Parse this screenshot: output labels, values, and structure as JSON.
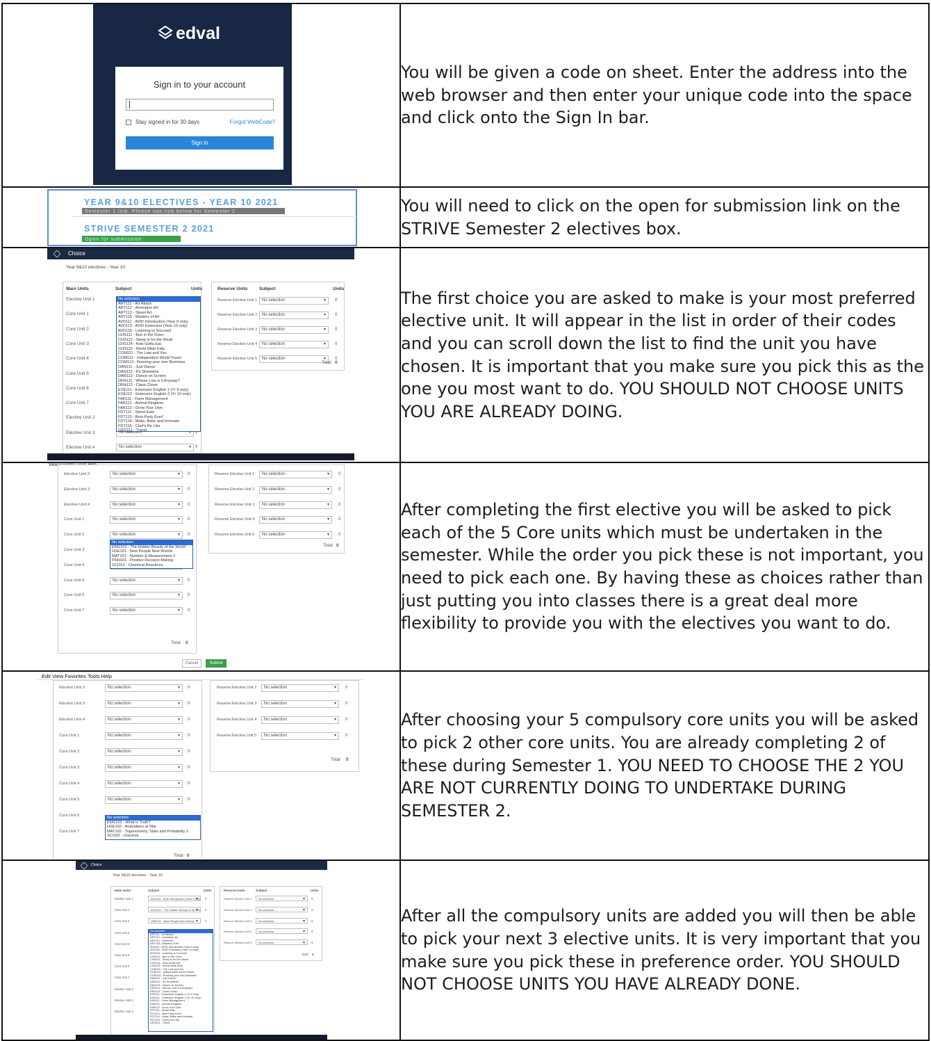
{
  "rows": [
    {
      "text": "You will be given a code on sheet. Enter the address into the web browser and then enter your unique code into the space and click onto the Sign In bar."
    },
    {
      "text": "You will need to click on the open for submission link on the STRIVE Semester 2 electives box."
    },
    {
      "text": "The first choice you are asked to make is your most preferred elective unit. It will appear in the list in order of their codes and you can scroll down the list to find the unit you have chosen. It is important that you make sure you pick this as the one you most want to do. YOU SHOULD NOT CHOOSE UNITS YOU ARE ALREADY DOING."
    },
    {
      "text": "After completing the first elective you will be asked to pick each of the 5 Core units which must be undertaken in the semester. While the order you pick these is not important, you need to pick each one. By having these as choices rather than just putting you into classes there is a great deal more flexibility to provide you with the electives you want to do."
    },
    {
      "text": "After choosing your 5 compulsory core units you will be asked to pick 2 other core units. You are already completing 2 of these during Semester 1. YOU NEED TO CHOOSE THE 2 YOU ARE NOT CURRENTLY DOING TO UNDERTAKE DURING SEMESTER 2."
    },
    {
      "text": "After all the compulsory units are added you will then be able to pick your next 3 elective units. It is very important that you make sure you pick these in preference order. YOU SHOULD NOT CHOOSE UNITS YOU HAVE ALREADY DONE."
    }
  ],
  "signin": {
    "brand": "edval",
    "title": "Sign in to your account",
    "stay": "Stay signed in for 30 days",
    "forgot": "Forgot WebCode?",
    "button": "Sign in"
  },
  "banner": {
    "title1": "YEAR 9&10 ELECTIVES - YEAR 10 2021",
    "note1": "Semester 1 link. Please use link below for Semester 2",
    "title2": "STRIVE SEMESTER 2 2021",
    "note2": "Open for submission"
  },
  "choice": {
    "app": "Choice",
    "heading": "Year 9&10 electives - Year 10",
    "main_units": "Main Units",
    "subject": "Subject",
    "units": "Units",
    "reserve_units": "Reserve Units",
    "total": "Total",
    "total_value": "0",
    "no_selection": "No selection",
    "cancel": "Cancel",
    "submit": "Submit"
  },
  "menubar": {
    "items": [
      "Edit",
      "View",
      "Favorites",
      "Tools",
      "Help"
    ],
    "items_cut": [
      "View",
      "Favorites",
      "Tools",
      "Help"
    ]
  },
  "labels": {
    "s3_main": [
      "Elective Unit 1",
      "Core Unit 1",
      "Core Unit 2",
      "Core Unit 3",
      "Core Unit 4",
      "Core Unit 5",
      "Core Unit 6",
      "Core Unit 7",
      "Elective Unit 2",
      "Elective Unit 3",
      "Elective Unit 4"
    ],
    "s4_main": [
      "Elective Unit 2",
      "Elective Unit 3",
      "Elective Unit 4",
      "Core Unit 1",
      "Core Unit 2",
      "Core Unit 3",
      "Core Unit 4",
      "Core Unit 5",
      "Core Unit 6",
      "Core Unit 7"
    ],
    "s5_main": [
      "Elective Unit 2",
      "Elective Unit 3",
      "Elective Unit 4",
      "Core Unit 1",
      "Core Unit 2",
      "Core Unit 3",
      "Core Unit 4",
      "Core Unit 5",
      "Core Unit 6",
      "Core Unit 7"
    ],
    "s6_main": [
      "Elective Unit 1",
      "Core Unit 1",
      "Core Unit 2",
      "Core Unit 3",
      "Core Unit 4",
      "Core Unit 5",
      "Core Unit 6",
      "Core Unit 7",
      "Elective Unit 2",
      "Elective Unit 3",
      "Elective Unit 4"
    ],
    "reserve": [
      "Reserve Elective Unit 1",
      "Reserve Elective Unit 2",
      "Reserve Elective Unit 3",
      "Reserve Elective Unit 4",
      "Reserve Elective Unit 5"
    ],
    "reserve4": [
      "Reserve Elective Unit 2",
      "Reserve Elective Unit 3",
      "Reserve Elective Unit 4",
      "Reserve Elective Unit 5"
    ]
  },
  "dropdown_electives": [
    "No selection",
    "ART111 - Art Attack",
    "ART112 - Animation Art",
    "ART113 - Street Art",
    "ART116 - Masters of Art",
    "AVD111 - AVID Introduction (Year 9 only)",
    "AVD113 - AVID Extension (Year 10 only)",
    "AVD115 - Learning to Succeed",
    "CHS111 - Bun in the Oven.",
    "CHS112 - Sleep is for the Weak",
    "CHS114 - Kids Gotta Eat.",
    "CHS115 - World Wide Kids.",
    "COM111 - The Law and You",
    "COM112 - Independent World Travel",
    "COM113 - Running your own Business",
    "DAN111 - Just Dance",
    "DAN112 - It's Showtime",
    "DAN113 - Dance on Screen",
    "DRA111 - Whose Line is it Anyway?",
    "DRA113 - Class Clown",
    "EXE111 - Extension English 1 (Yr 9 only)",
    "EXE112 - Extension English 2 (Yr 10 only)",
    "FAR111 - Farm Management",
    "FAR112 - Animal Kingdom",
    "FAR113 - Grow Your Own",
    "FDT111 - Street Eats",
    "FDT113 - Best Party Ever!",
    "FDT114 - Make, Bake and Innovate",
    "FDT115 - Chef's Be Like",
    "GEO111 - Travel"
  ],
  "dropdown_core1": [
    "No selection",
    "ENG101 - The Hidden Beauty of the World",
    "HSE101 - New People New Worlds",
    "MAT101 - Number & Measurement 2",
    "PDH101 - Positive Decision Making",
    "SCI101 - Chemical Reactions"
  ],
  "dropdown_core2": [
    "No selection",
    "ENG102 - What is Truth?",
    "HSE102 - Australians at War",
    "MAT102 - Trigonometry, Stats and Probability 2",
    "SCI102 - Universe"
  ],
  "s6_values": [
    "AVD115 - AVID Introduction (Year 9 only)",
    "ENG101 - The Hidden Beauty of the World",
    "HSE101 - New People New Worlds",
    "MAT101 - Number & Measurement 2"
  ],
  "s6_units": [
    "2",
    "2",
    "2",
    "2"
  ]
}
